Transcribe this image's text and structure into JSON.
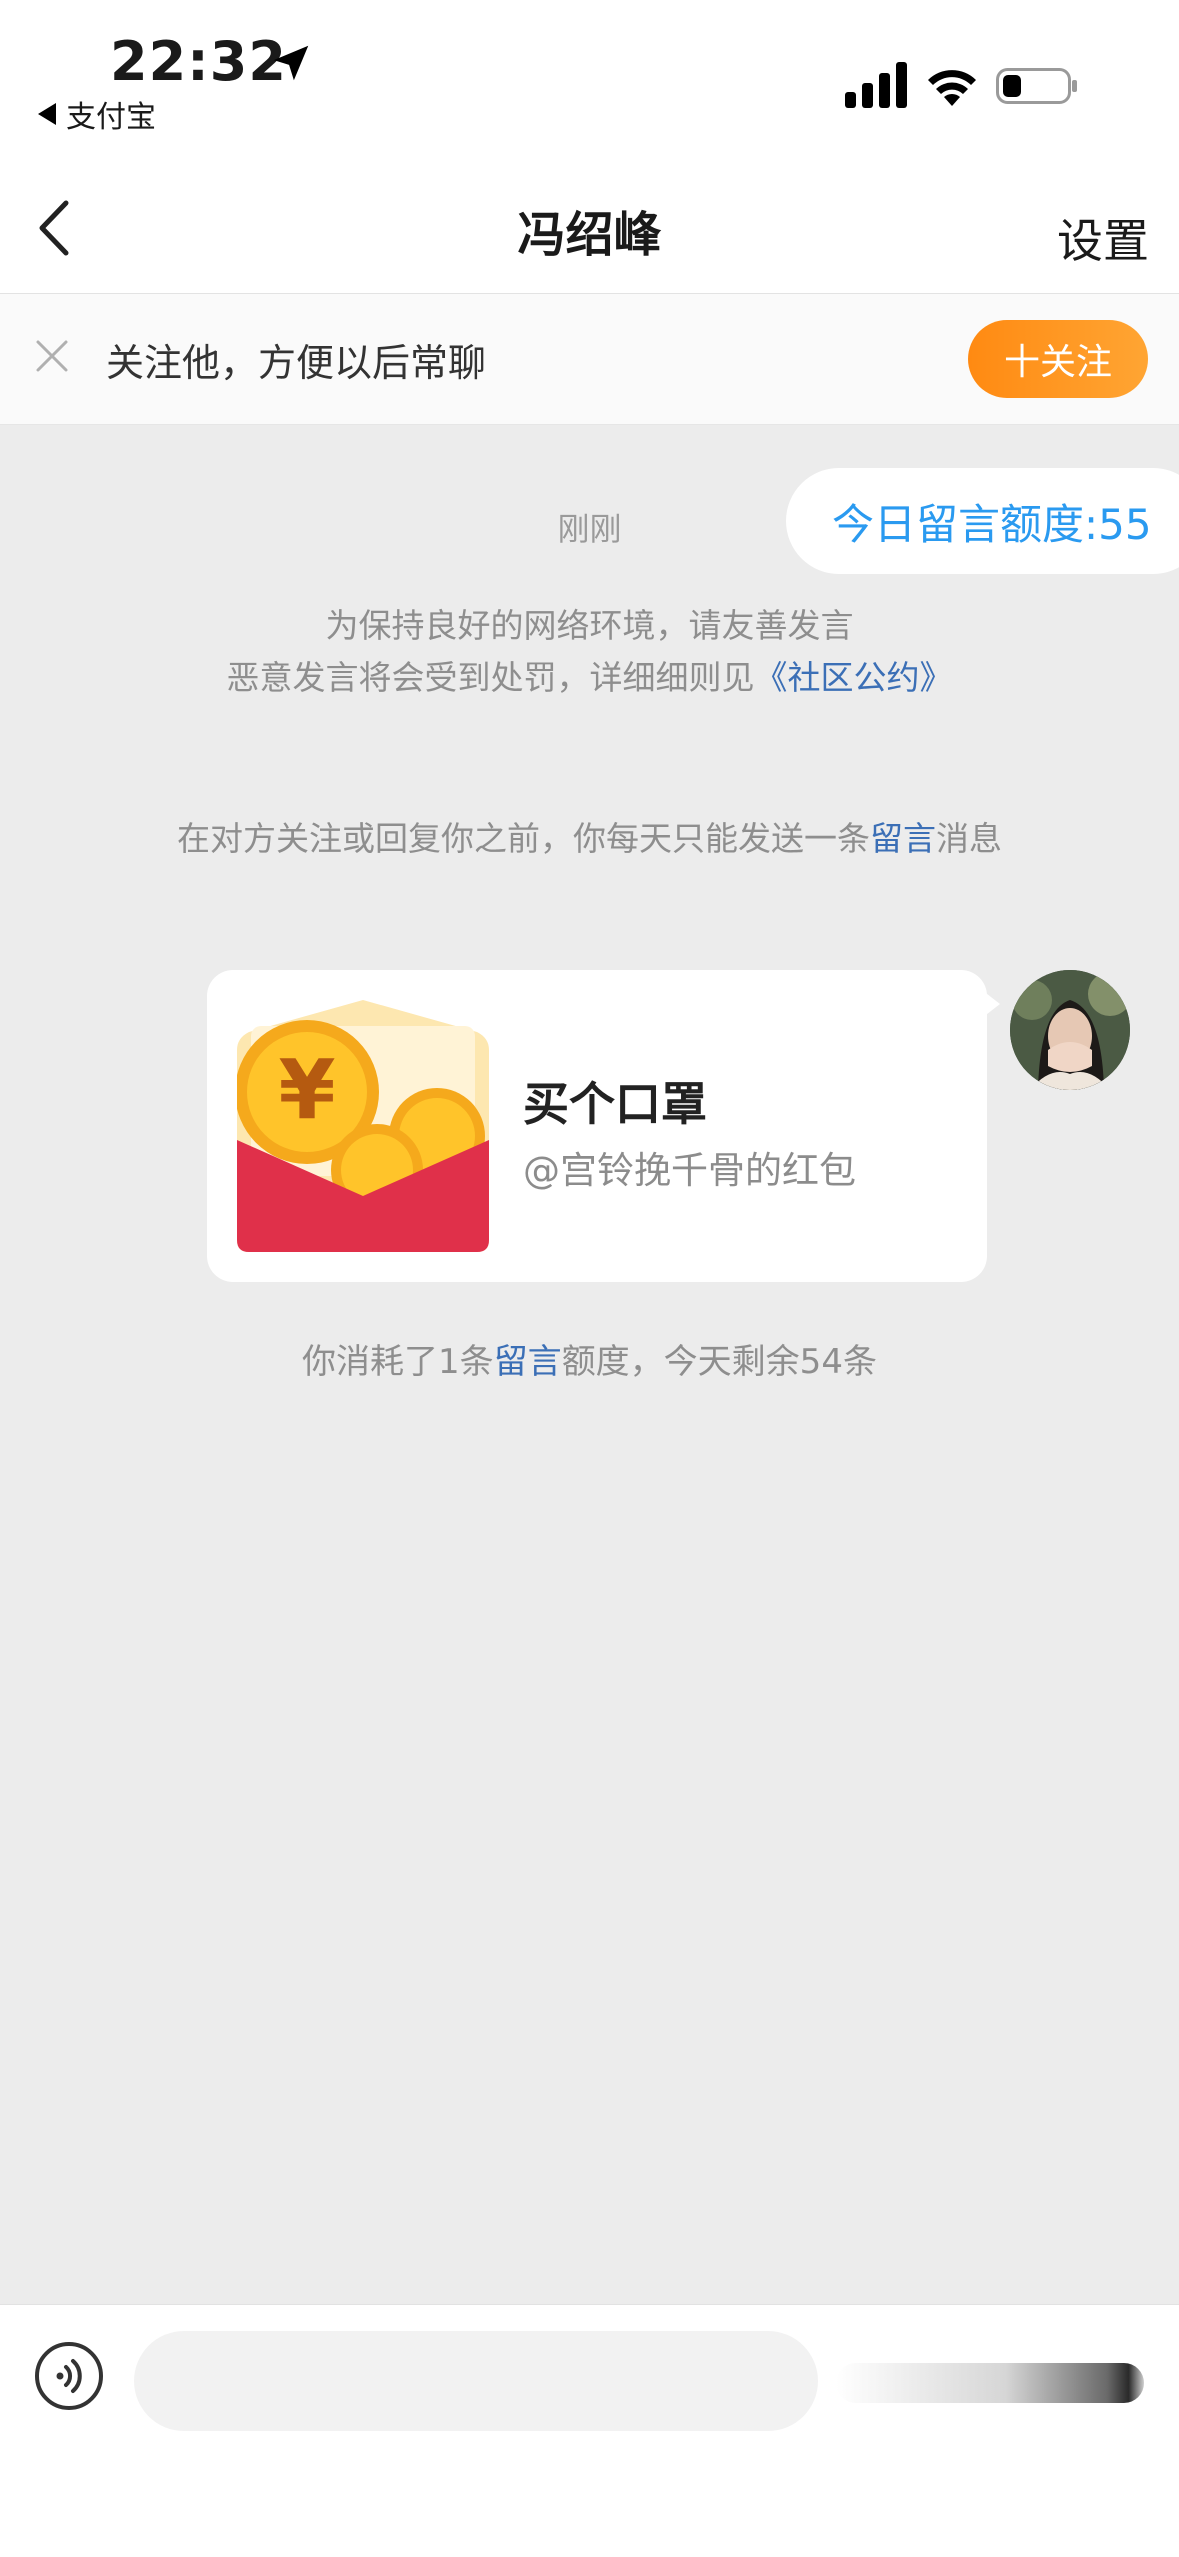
{
  "status_bar": {
    "time": "22:32",
    "back_app": "支付宝"
  },
  "nav": {
    "title": "冯绍峰",
    "settings_label": "设置"
  },
  "follow_bar": {
    "text": "关注他，方便以后常聊",
    "button_label": "十关注"
  },
  "chat": {
    "quota_pill": "今日留言额度:55",
    "timestamp": "刚刚",
    "notice_line1": "为保持良好的网络环境，请友善发言",
    "notice_line2_prefix": "恶意发言将会受到处罚，详细细则见",
    "notice_link": "《社区公约》",
    "limit_prefix": "在对方关注或回复你之前，你每天只能发送一条",
    "limit_link": "留言",
    "limit_suffix": "消息",
    "red_packet": {
      "title": "买个口罩",
      "subtitle": "@宫铃挽千骨的红包",
      "currency_symbol": "¥"
    },
    "consume_prefix": "你消耗了1条",
    "consume_link": "留言",
    "consume_suffix": "额度，今天剩余54条"
  },
  "input_bar": {
    "placeholder": ""
  },
  "colors": {
    "accent_orange": "#ff8a12",
    "link_blue": "#3b6fb6",
    "quota_blue": "#2a9af0",
    "red_packet": "#e0304a",
    "background": "#ececec"
  },
  "icons": [
    "location-arrow-icon",
    "signal-icon",
    "wifi-icon",
    "battery-icon",
    "back-chevron-icon",
    "close-icon",
    "voice-icon",
    "yuan-coin-icon"
  ]
}
